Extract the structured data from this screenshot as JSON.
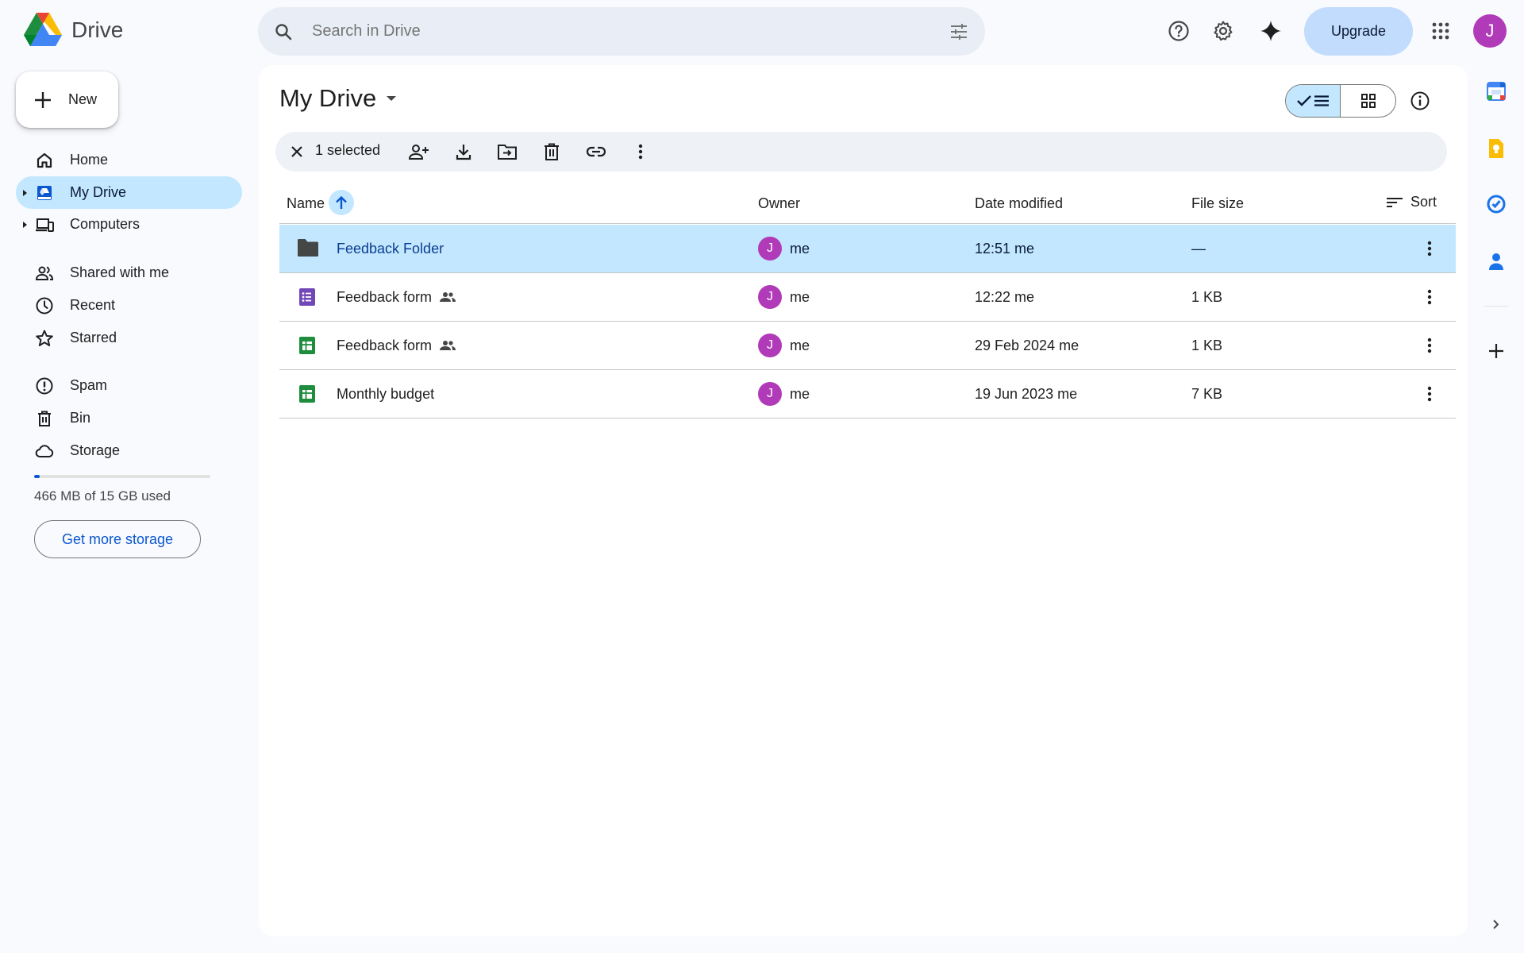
{
  "app": {
    "name": "Drive"
  },
  "search": {
    "placeholder": "Search in Drive"
  },
  "header": {
    "upgrade_label": "Upgrade",
    "avatar_initial": "J"
  },
  "sidebar": {
    "new_label": "New",
    "items": [
      {
        "label": "Home",
        "icon": "home-icon"
      },
      {
        "label": "My Drive",
        "icon": "my-drive-icon",
        "active": true
      },
      {
        "label": "Computers",
        "icon": "computers-icon"
      },
      {
        "label": "Shared with me",
        "icon": "shared-icon"
      },
      {
        "label": "Recent",
        "icon": "clock-icon"
      },
      {
        "label": "Starred",
        "icon": "star-icon"
      },
      {
        "label": "Spam",
        "icon": "spam-icon"
      },
      {
        "label": "Bin",
        "icon": "bin-icon"
      },
      {
        "label": "Storage",
        "icon": "cloud-icon"
      }
    ],
    "storage": {
      "used_text": "466 MB of 15 GB used",
      "used_fraction": 0.031,
      "button_label": "Get more storage"
    }
  },
  "main": {
    "title": "My Drive",
    "selection": {
      "count_text": "1 selected"
    },
    "columns": {
      "name": "Name",
      "owner": "Owner",
      "date": "Date modified",
      "size": "File size",
      "sort": "Sort"
    },
    "rows": [
      {
        "name": "Feedback Folder",
        "type": "folder",
        "shared": false,
        "owner_initial": "J",
        "owner": "me",
        "date": "12:51 me",
        "size": "—",
        "selected": true
      },
      {
        "name": "Feedback form",
        "type": "form",
        "shared": true,
        "owner_initial": "J",
        "owner": "me",
        "date": "12:22 me",
        "size": "1 KB",
        "selected": false
      },
      {
        "name": "Feedback form",
        "type": "sheet",
        "shared": true,
        "owner_initial": "J",
        "owner": "me",
        "date": "29 Feb 2024 me",
        "size": "1 KB",
        "selected": false
      },
      {
        "name": "Monthly budget",
        "type": "sheet",
        "shared": false,
        "owner_initial": "J",
        "owner": "me",
        "date": "19 Jun 2023 me",
        "size": "7 KB",
        "selected": false
      }
    ]
  },
  "colors": {
    "accent": "#0b57d0",
    "selected_bg": "#c2e7ff",
    "avatar": "#b03ab7",
    "form": "#7248b9",
    "sheet": "#1e8e3e"
  }
}
